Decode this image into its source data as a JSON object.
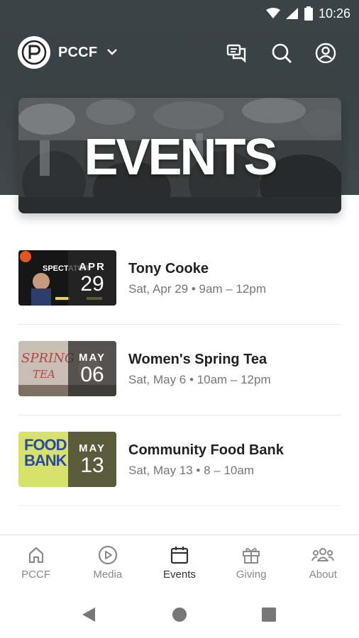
{
  "status": {
    "time": "10:26"
  },
  "header": {
    "org_name": "PCCF",
    "logo_letter": "P"
  },
  "banner": {
    "title": "EVENTS"
  },
  "events": [
    {
      "title": "Tony Cooke",
      "time": "Sat, Apr 29 • 9am – 12pm",
      "month": "APR",
      "day": "29"
    },
    {
      "title": "Women's Spring Tea",
      "time": "Sat, May 6 • 10am – 12pm",
      "month": "MAY",
      "day": "06"
    },
    {
      "title": "Community Food Bank",
      "time": "Sat, May 13 • 8 – 10am",
      "month": "MAY",
      "day": "13"
    }
  ],
  "thumb_text": {
    "spectator": "SPECTATOR",
    "spring": "SPRING",
    "tea": "TEA",
    "food": "FOOD",
    "bank": "BANK"
  },
  "nav": [
    {
      "label": "PCCF",
      "icon": "home-icon"
    },
    {
      "label": "Media",
      "icon": "play-icon"
    },
    {
      "label": "Events",
      "icon": "calendar-icon"
    },
    {
      "label": "Giving",
      "icon": "gift-icon"
    },
    {
      "label": "About",
      "icon": "people-icon"
    }
  ],
  "colors": {
    "header": "#394245",
    "active_nav": "#333333",
    "inactive_nav": "#8a8a8a",
    "food_bank_bg": "#d7e26b"
  }
}
